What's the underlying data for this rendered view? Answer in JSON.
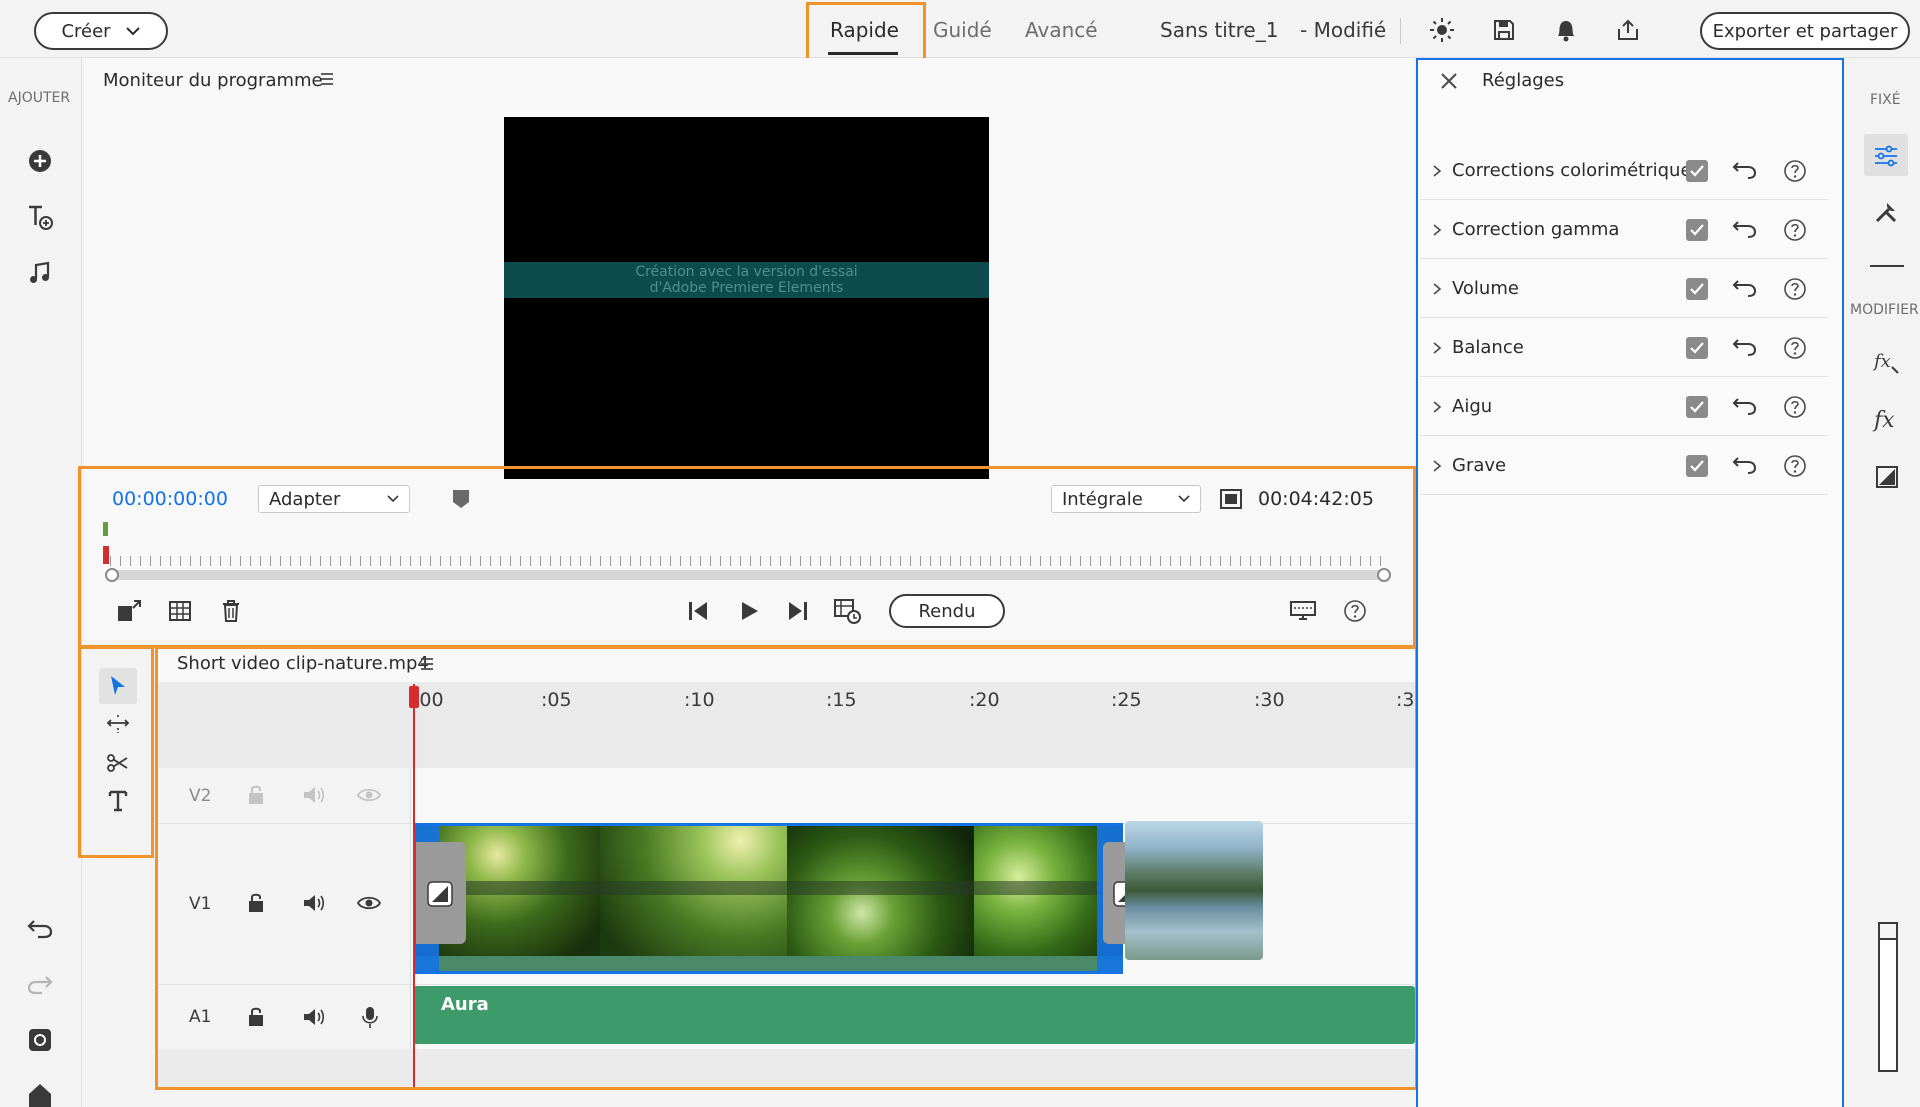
{
  "header": {
    "create_button": "Créer",
    "tabs": [
      "Rapide",
      "Guidé",
      "Avancé"
    ],
    "project_title": "Sans titre_1",
    "modified_label": "- Modifié",
    "export_button": "Exporter et partager"
  },
  "left_toolbar": {
    "section_label": "AJOUTER"
  },
  "monitor": {
    "title": "Moniteur du programme",
    "watermark_line1": "Création avec la version d'essai",
    "watermark_line2": "d'Adobe Premiere Elements",
    "timecode": "00:00:00:00",
    "fit_select": "Adapter",
    "quality_select": "Intégrale",
    "duration": "00:04:42:05",
    "render_button": "Rendu"
  },
  "timeline": {
    "title": "Short video clip-nature.mp4",
    "ruler_labels": [
      ":00",
      ":05",
      ":10",
      ":15",
      ":20",
      ":25",
      ":30",
      ":3"
    ],
    "tracks": [
      "V2",
      "V1",
      "A1"
    ],
    "audio_clip_label": "Aura"
  },
  "settings_panel": {
    "title": "Réglages",
    "items": [
      "Corrections colorimétriques",
      "Correction gamma",
      "Volume",
      "Balance",
      "Aigu",
      "Grave"
    ]
  },
  "right_rail": {
    "fixed_label": "FIXÉ",
    "modify_label": "MODIFIER"
  },
  "colors": {
    "accent_orange": "#f0932b",
    "timecode_blue": "#1473e6",
    "audio_green": "#3d9a6a",
    "playhead_red": "#d62c2c"
  }
}
